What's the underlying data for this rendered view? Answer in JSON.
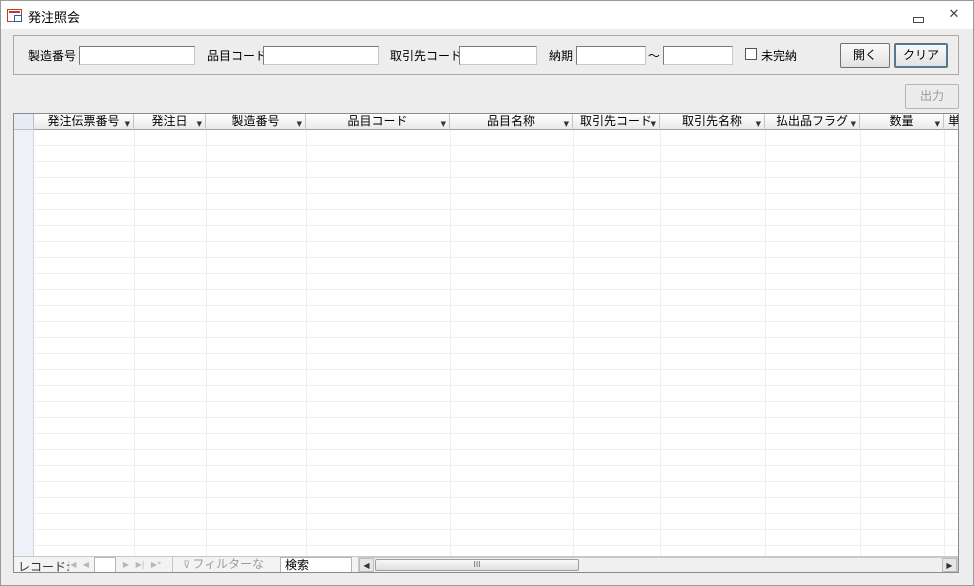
{
  "window": {
    "title": "発注照会"
  },
  "filters": {
    "seizo_bango_label": "製造番号",
    "hinmoku_code_label": "品目コード",
    "torihikisaki_code_label": "取引先コード",
    "noki_label": "納期",
    "range_separator": "～",
    "mikannou_label": "未完納"
  },
  "buttons": {
    "open": "開く",
    "clear": "クリア",
    "output": "出力"
  },
  "grid": {
    "columns": [
      "発注伝票番号",
      "発注日",
      "製造番号",
      "品目コード",
      "品目名称",
      "取引先コード",
      "取引先名称",
      "払出品フラグ",
      "数量",
      "単"
    ]
  },
  "navigation": {
    "record_label": "レコード:",
    "filter_status": "フィルターなし",
    "search_label": "検索",
    "scroll_thumb": "III"
  },
  "colors": {
    "accent": "#3c7fb1",
    "app_icon": "#c0392b"
  }
}
